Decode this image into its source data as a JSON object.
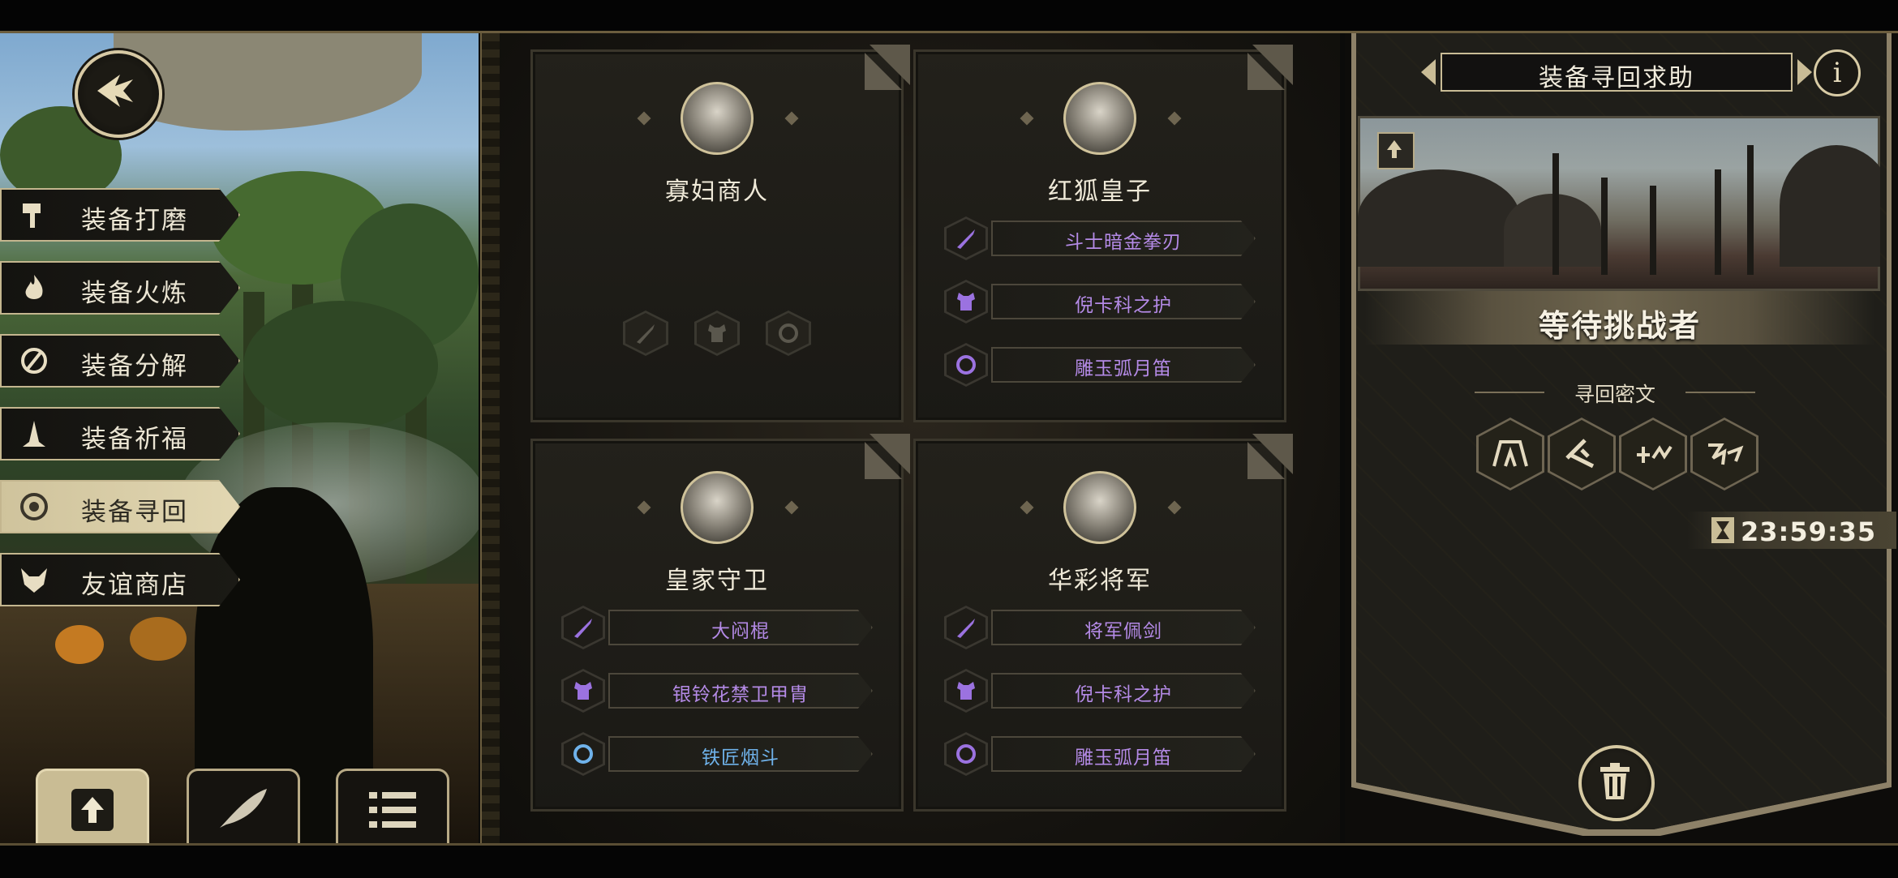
{
  "screen": {
    "title": "装备寻回求助",
    "status_text": "等待挑战者",
    "cipher_label": "寻回密文",
    "timer": "23:59:35"
  },
  "side_menu": {
    "items": [
      {
        "label": "装备打磨",
        "icon": "hammer-icon",
        "active": false
      },
      {
        "label": "装备火炼",
        "icon": "flame-icon",
        "active": false
      },
      {
        "label": "装备分解",
        "icon": "disassemble-icon",
        "active": false
      },
      {
        "label": "装备祈福",
        "icon": "pray-icon",
        "active": false
      },
      {
        "label": "装备寻回",
        "icon": "target-icon",
        "active": true
      },
      {
        "label": "友谊商店",
        "icon": "fox-icon",
        "active": false
      }
    ]
  },
  "bottom_nav": [
    {
      "icon": "upload-icon",
      "selected": true
    },
    {
      "icon": "feather-icon",
      "selected": false
    },
    {
      "icon": "list-icon",
      "selected": false
    }
  ],
  "cards": [
    {
      "name": "寡妇商人",
      "equipment": []
    },
    {
      "name": "红狐皇子",
      "equipment": [
        {
          "slot": "weapon",
          "label": "斗士暗金拳刃",
          "rarity_color": "#b48ae6"
        },
        {
          "slot": "armor",
          "label": "倪卡科之护",
          "rarity_color": "#b48ae6"
        },
        {
          "slot": "accessory",
          "label": "雕玉弧月笛",
          "rarity_color": "#b48ae6"
        }
      ]
    },
    {
      "name": "皇家守卫",
      "equipment": [
        {
          "slot": "weapon",
          "label": "大闷棍",
          "rarity_color": "#b48ae6"
        },
        {
          "slot": "armor",
          "label": "银铃花禁卫甲胄",
          "rarity_color": "#b48ae6"
        },
        {
          "slot": "accessory",
          "label": "铁匠烟斗",
          "rarity_color": "#6fb2ea"
        }
      ]
    },
    {
      "name": "华彩将军",
      "equipment": [
        {
          "slot": "weapon",
          "label": "将军佩剑",
          "rarity_color": "#b48ae6"
        },
        {
          "slot": "armor",
          "label": "倪卡科之护",
          "rarity_color": "#b48ae6"
        },
        {
          "slot": "accessory",
          "label": "雕玉弧月笛",
          "rarity_color": "#b48ae6"
        }
      ]
    }
  ],
  "cipher_runes": [
    "rune-1-icon",
    "rune-2-icon",
    "rune-3-icon",
    "rune-4-icon"
  ],
  "colors": {
    "accent_gold": "#d7c9a4",
    "epic_purple": "#b48ae6",
    "rare_blue": "#6fb2ea",
    "panel_dark": "#1a1915"
  }
}
